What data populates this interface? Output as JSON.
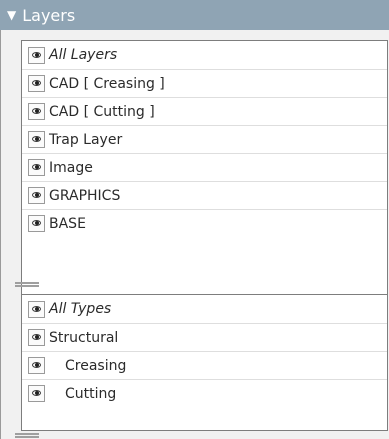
{
  "panel": {
    "title": "Layers",
    "icon": "triangle-down-icon",
    "header_color": "#8fa4b4"
  },
  "layers": [
    {
      "label": "All Layers",
      "italic": true
    },
    {
      "label": "CAD [ Creasing ]"
    },
    {
      "label": "CAD [ Cutting ]"
    },
    {
      "label": "Trap Layer"
    },
    {
      "label": "Image"
    },
    {
      "label": "GRAPHICS"
    },
    {
      "label": "BASE"
    }
  ],
  "types": [
    {
      "label": "All Types",
      "italic": true
    },
    {
      "label": "Structural"
    },
    {
      "label": "Creasing",
      "indent": true
    },
    {
      "label": "Cutting",
      "indent": true
    }
  ],
  "icons": {
    "visibility": "eye-icon"
  }
}
